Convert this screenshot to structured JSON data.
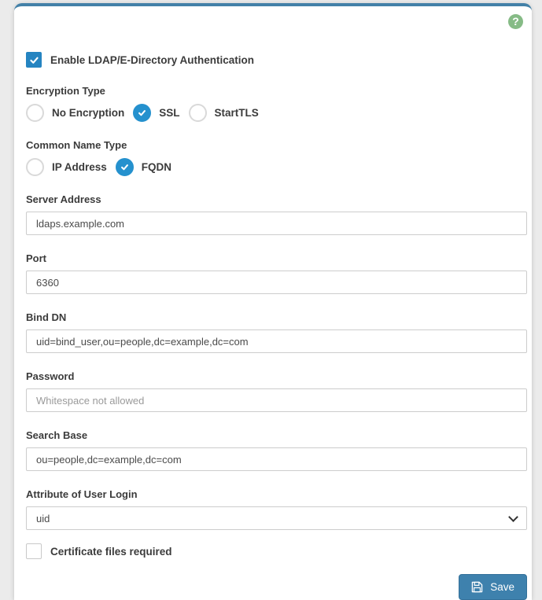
{
  "header": {
    "help_icon_glyph": "?"
  },
  "form": {
    "enable_auth": {
      "label": "Enable LDAP/E-Directory Authentication",
      "checked": true
    },
    "encryption_type": {
      "label": "Encryption Type",
      "options": [
        {
          "label": "No Encryption",
          "selected": false
        },
        {
          "label": "SSL",
          "selected": true
        },
        {
          "label": "StartTLS",
          "selected": false
        }
      ]
    },
    "common_name_type": {
      "label": "Common Name Type",
      "options": [
        {
          "label": "IP Address",
          "selected": false
        },
        {
          "label": "FQDN",
          "selected": true
        }
      ]
    },
    "server_address": {
      "label": "Server Address",
      "value": "ldaps.example.com"
    },
    "port": {
      "label": "Port",
      "value": "6360"
    },
    "bind_dn": {
      "label": "Bind DN",
      "value": "uid=bind_user,ou=people,dc=example,dc=com"
    },
    "password": {
      "label": "Password",
      "value": "",
      "placeholder": "Whitespace not allowed"
    },
    "search_base": {
      "label": "Search Base",
      "value": "ou=people,dc=example,dc=com"
    },
    "attribute_of_user_login": {
      "label": "Attribute of User Login",
      "selected_option": "uid"
    },
    "certificate_files": {
      "label": "Certificate files required",
      "checked": false
    }
  },
  "actions": {
    "save_label": "Save"
  },
  "colors": {
    "accent_blue": "#2591ce",
    "checkbox_blue": "#2584c1",
    "button_blue": "#3e81ad",
    "card_top_border": "#4381a8",
    "help_green": "#86bb86"
  }
}
